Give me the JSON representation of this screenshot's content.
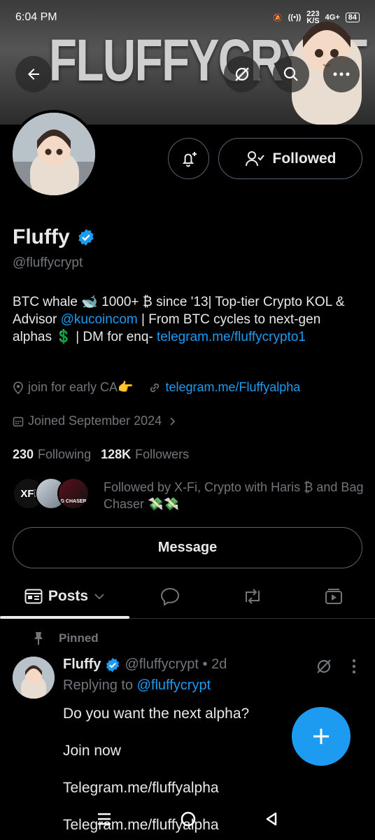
{
  "status": {
    "time": "6:04 PM",
    "speed": "223\nK/S",
    "network": "4G+",
    "battery": "84"
  },
  "banner": {
    "text": "FLUFFYCRYPT"
  },
  "profile": {
    "name": "Fluffy",
    "handle": "@fluffycrypt",
    "followed_label": "Followed",
    "bio_part1": "BTC whale 🐋 1000+ ₿ since '13| Top-tier Crypto KOL & Advisor ",
    "bio_mention": "@kucoincom",
    "bio_part2": " | From BTC cycles to next-gen alphas 💲 | DM for enq- ",
    "bio_link": "telegram.me/fluffycrypto1",
    "location": "join for early CA👉",
    "website": "telegram.me/Fluffyalpha",
    "joined": "Joined September 2024",
    "following_count": "230",
    "following_label": "Following",
    "followers_count": "128K",
    "followers_label": "Followers",
    "followed_by": "Followed by X-Fi, Crypto with Haris ₿ and Bag Chaser 💸💸",
    "mini_avatar_labels": [
      "XFi",
      "G CHASER"
    ],
    "message_label": "Message"
  },
  "tabs": {
    "posts_label": "Posts"
  },
  "post": {
    "pinned_label": "Pinned",
    "author": "Fluffy",
    "meta": "@fluffycrypt • 2d",
    "reply_prefix": "Replying to ",
    "reply_handle": "@fluffycrypt",
    "line1": "Do you want the next alpha?",
    "line2": "Join now",
    "link1": "Telegram.me/fluffyalpha",
    "link2": "Telegram.me/fluffyalpha"
  },
  "colors": {
    "accent": "#1d9bf0",
    "bg": "#000000",
    "muted": "#71767b"
  }
}
